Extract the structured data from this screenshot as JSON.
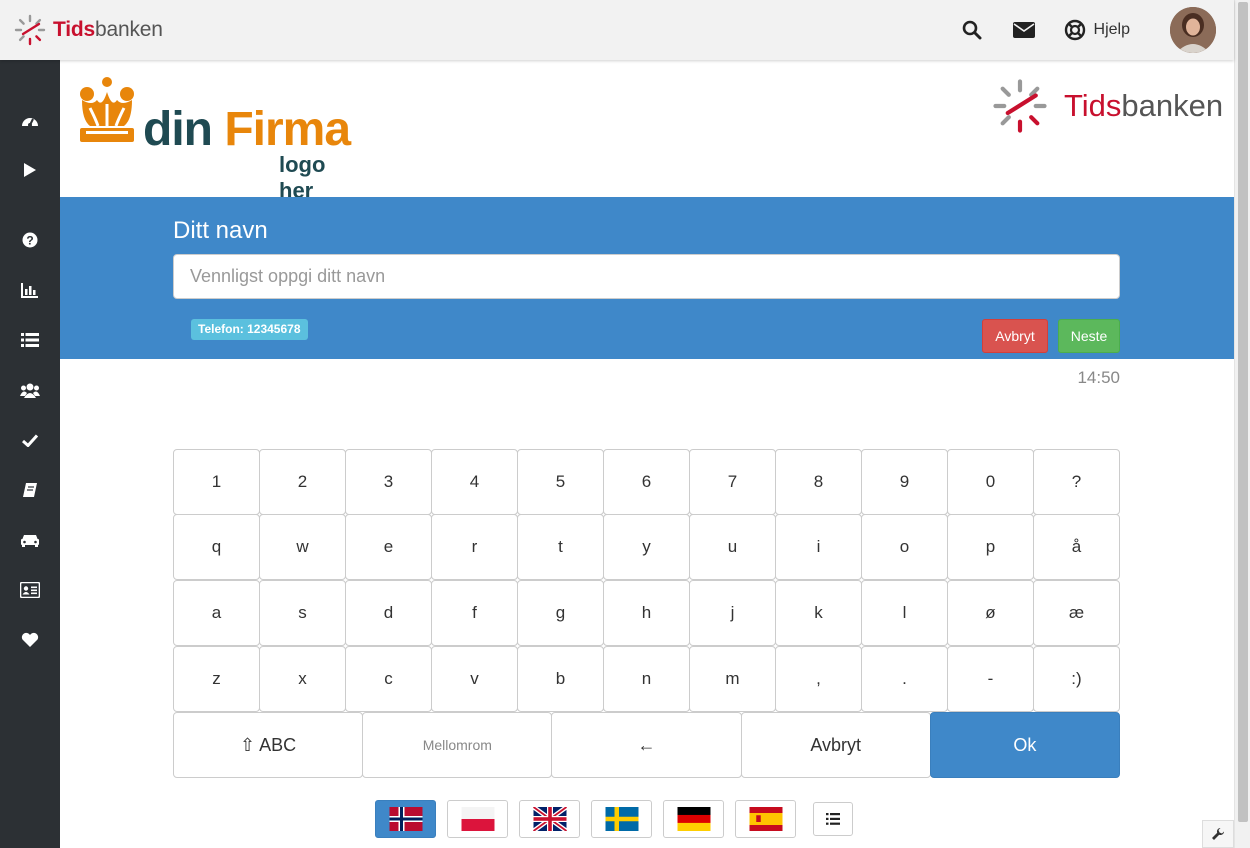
{
  "app": {
    "brand_tids": "Tids",
    "brand_banken": "banken"
  },
  "topbar": {
    "help_label": "Hjelp"
  },
  "sidebar": {
    "items": [
      {
        "icon": "dashboard-icon"
      },
      {
        "icon": "play-icon"
      },
      {
        "icon": "question-icon"
      },
      {
        "icon": "bar-chart-icon"
      },
      {
        "icon": "list-icon"
      },
      {
        "icon": "users-icon"
      },
      {
        "icon": "check-icon"
      },
      {
        "icon": "book-icon"
      },
      {
        "icon": "car-icon"
      },
      {
        "icon": "id-card-icon"
      },
      {
        "icon": "heart-icon"
      }
    ]
  },
  "company_logo": {
    "din": "din ",
    "firma": "Firma",
    "sub": "logo her"
  },
  "form": {
    "title": "Ditt navn",
    "input_placeholder": "Vennligst oppgi ditt navn",
    "input_value": "",
    "phone_badge": "Telefon: 12345678",
    "cancel_label": "Avbryt",
    "next_label": "Neste"
  },
  "clock": "14:50",
  "keyboard": {
    "row1": [
      "1",
      "2",
      "3",
      "4",
      "5",
      "6",
      "7",
      "8",
      "9",
      "0",
      "?"
    ],
    "row2": [
      "q",
      "w",
      "e",
      "r",
      "t",
      "y",
      "u",
      "i",
      "o",
      "p",
      "å"
    ],
    "row3": [
      "a",
      "s",
      "d",
      "f",
      "g",
      "h",
      "j",
      "k",
      "l",
      "ø",
      "æ"
    ],
    "row4": [
      "z",
      "x",
      "c",
      "v",
      "b",
      "n",
      "m",
      ",",
      ".",
      "-",
      ":)"
    ],
    "shift_label": "⇧ ABC",
    "space_label": "Mellomrom",
    "backspace_label": "←",
    "cancel_label": "Avbryt",
    "ok_label": "Ok"
  },
  "languages": [
    {
      "flag": "norway-flag-icon",
      "active": true
    },
    {
      "flag": "poland-flag-icon",
      "active": false
    },
    {
      "flag": "uk-flag-icon",
      "active": false
    },
    {
      "flag": "sweden-flag-icon",
      "active": false
    },
    {
      "flag": "germany-flag-icon",
      "active": false
    },
    {
      "flag": "spain-flag-icon",
      "active": false
    }
  ],
  "colors": {
    "band": "#3f88c9",
    "sidebar": "#2c3034",
    "brand_red": "#c8102e",
    "firm_orange": "#e8860b",
    "firm_teal": "#1f4a52"
  }
}
